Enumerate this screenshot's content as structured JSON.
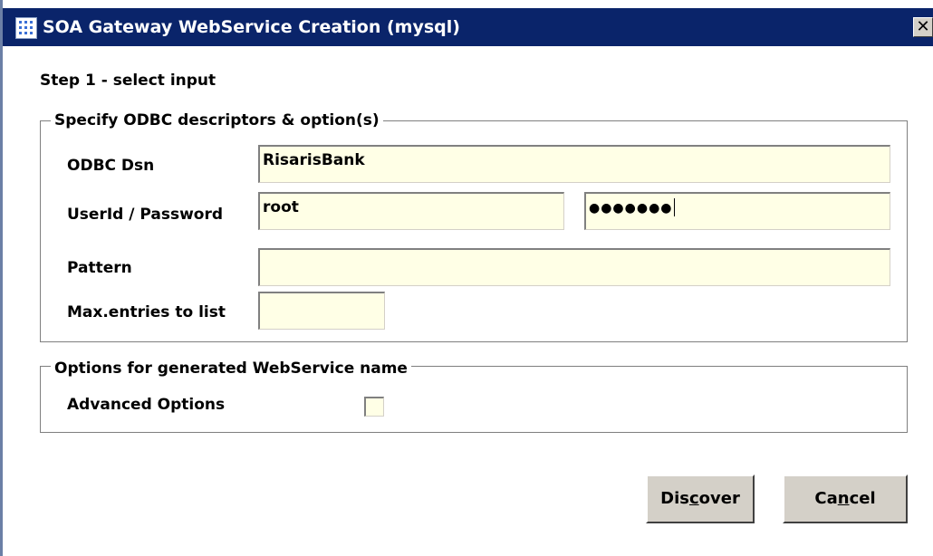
{
  "window": {
    "title": "SOA Gateway WebService Creation (mysql)",
    "close_glyph": "✕",
    "app_icon": "grid-dots-icon"
  },
  "step_label": "Step 1 - select input",
  "odbc_group": {
    "legend": "Specify ODBC descriptors & option(s)",
    "dsn_label": "ODBC Dsn",
    "dsn_value": "RisarisBank",
    "userid_label": "UserId / Password",
    "userid_value": "root",
    "password_masked": "●●●●●●●",
    "pattern_label": "Pattern",
    "pattern_value": "",
    "max_entries_label": "Max.entries to list",
    "max_entries_value": ""
  },
  "options_group": {
    "legend": "Options for generated WebService name",
    "advanced_label": "Advanced Options",
    "advanced_checked": false
  },
  "buttons": {
    "discover_pre": "Dis",
    "discover_mnemonic": "c",
    "discover_post": "over",
    "cancel_pre": "Ca",
    "cancel_mnemonic": "n",
    "cancel_post": "cel"
  },
  "colors": {
    "titlebar": "#0a246a",
    "field_bg": "#ffffe6",
    "button_face": "#d4d0c8"
  }
}
